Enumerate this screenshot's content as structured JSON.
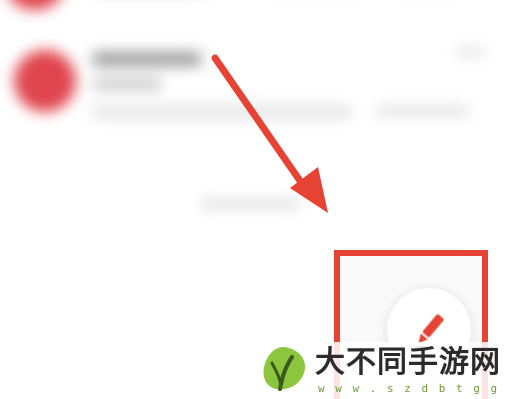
{
  "watermark": {
    "title": "大不同手游网",
    "url": "w w w . s z d b t g g . c o m"
  },
  "colors": {
    "annotation": "#e64334",
    "avatar": "#e0454e",
    "logo_green": "#8cc63f",
    "logo_dark": "#3a5a1a"
  },
  "icons": {
    "fab": "pencil-icon",
    "logo": "leaf-logo-icon"
  }
}
